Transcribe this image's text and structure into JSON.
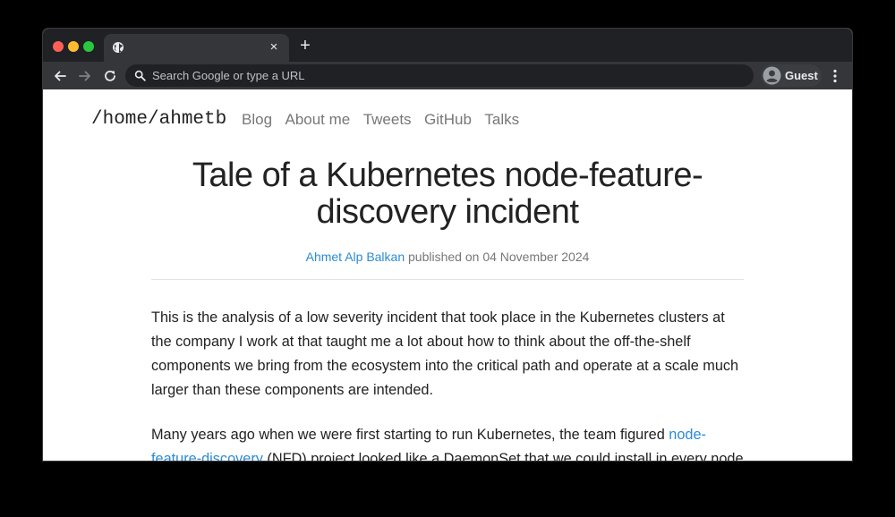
{
  "browser": {
    "tab": {
      "title": "",
      "favicon": "globe-icon",
      "close_label": "×"
    },
    "new_tab_label": "+",
    "omnibox": {
      "placeholder": "Search Google or type a URL"
    },
    "profile": {
      "label": "Guest",
      "avatar": "person-icon"
    },
    "colors": {
      "chrome_dark": "#202124",
      "chrome_mid": "#35363a"
    }
  },
  "site": {
    "title": "/home/ahmetb",
    "nav": [
      "Blog",
      "About me",
      "Tweets",
      "GitHub",
      "Talks"
    ]
  },
  "post": {
    "title": "Tale of a Kubernetes node-feature-discovery incident",
    "author": "Ahmet Alp Balkan",
    "published_text": " published on ",
    "date": "04 November 2024",
    "paragraph1": "This is the analysis of a low severity incident that took place in the Kubernetes clusters at the company I work at that taught me a lot about how to think about the off-the-shelf components we bring from the ecosystem into the critical path and operate at a scale much larger than these components are intended.",
    "paragraph2_before": "Many years ago when we were first starting to run Kubernetes, the team figured ",
    "paragraph2_link": "node-feature-discovery",
    "paragraph2_after": " (NFD) project looked like a DaemonSet that we could install in every node to expose"
  },
  "colors": {
    "link": "#2a8bd6",
    "text": "#222222",
    "muted": "#777777"
  }
}
